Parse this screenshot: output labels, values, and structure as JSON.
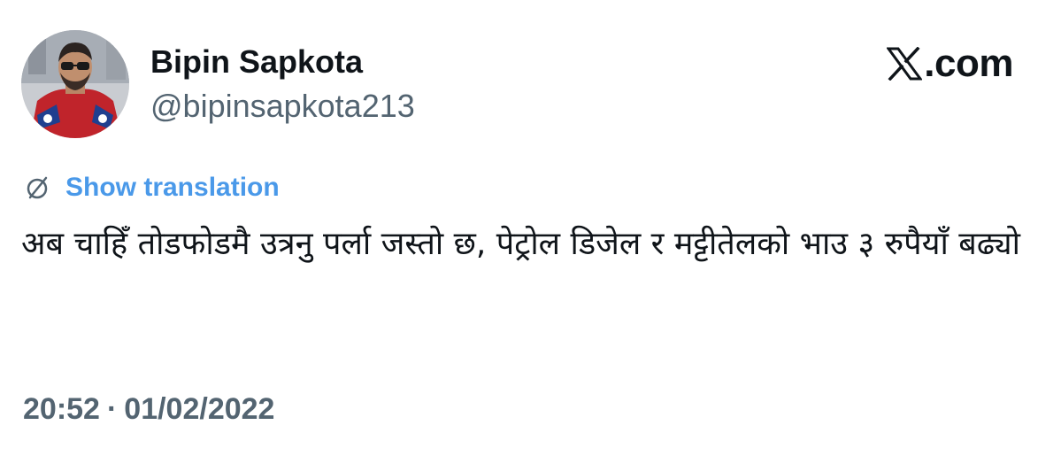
{
  "author": {
    "display_name": "Bipin Sapkota",
    "handle": "@bipinsapkota213"
  },
  "brand": {
    "text": ".com",
    "icon": "x-logo-icon"
  },
  "translation": {
    "icon": "globe-icon",
    "label": "Show translation",
    "color": "#4a99e9"
  },
  "tweet": {
    "text": "अब चाहिँ तोडफोडमै उत्रनु पर्ला जस्तो छ, पेट्रोल डिजेल र मट्टीतेलको भाउ ३ रुपैयाँ बढ्यो"
  },
  "meta": {
    "time": "20:52",
    "separator": "·",
    "date": "01/02/2022"
  },
  "colors": {
    "text_primary": "#0f1419",
    "text_secondary": "#536471",
    "link": "#4a99e9",
    "background": "#ffffff"
  }
}
